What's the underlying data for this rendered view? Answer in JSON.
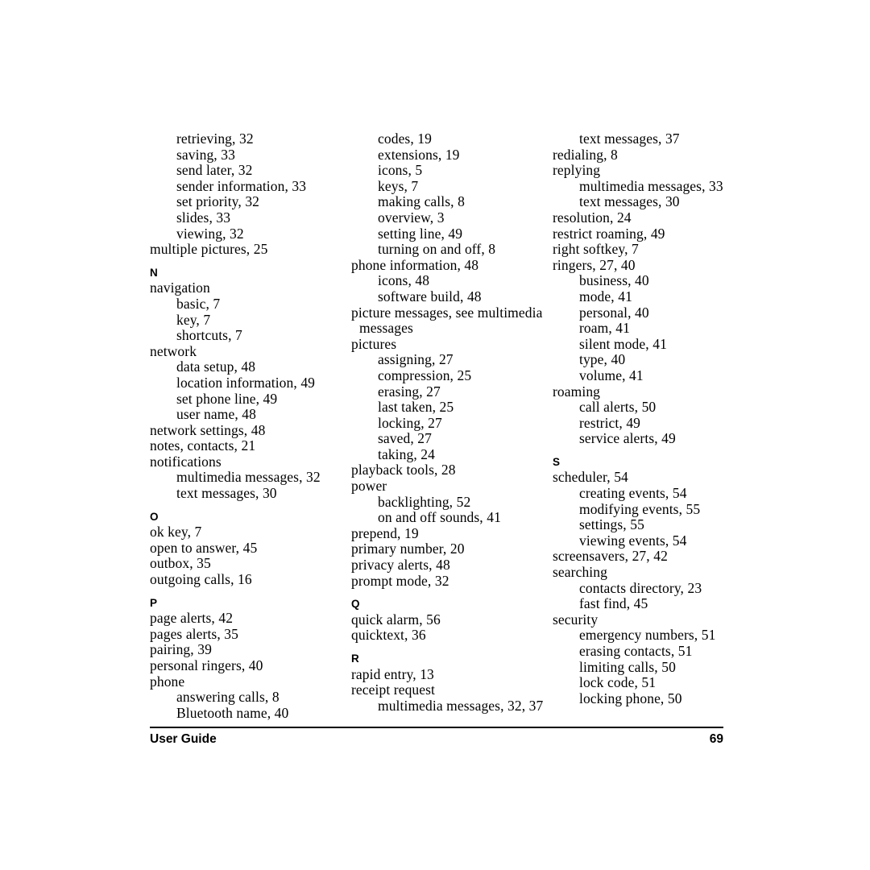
{
  "document": {
    "type": "index-page",
    "page_number": "69",
    "footer": {
      "left_label": "User Guide",
      "right_label": "69"
    },
    "colors": {
      "text": "#000000",
      "background": "#ffffff",
      "rule": "#000000"
    }
  },
  "columns": [
    {
      "id": "column-1",
      "blocks": [
        {
          "type": "entries",
          "entries": [
            {
              "level": 2,
              "text": "retrieving, 32"
            },
            {
              "level": 2,
              "text": "saving, 33"
            },
            {
              "level": 2,
              "text": "send later, 32"
            },
            {
              "level": 2,
              "text": "sender information, 33"
            },
            {
              "level": 2,
              "text": "set priority, 32"
            },
            {
              "level": 2,
              "text": "slides, 33"
            },
            {
              "level": 2,
              "text": "viewing, 32"
            },
            {
              "level": 1,
              "text": "multiple pictures, 25"
            }
          ]
        },
        {
          "type": "letter",
          "letter": "N",
          "entries": [
            {
              "level": 1,
              "text": "navigation"
            },
            {
              "level": 2,
              "text": "basic, 7"
            },
            {
              "level": 2,
              "text": "key, 7"
            },
            {
              "level": 2,
              "text": "shortcuts, 7"
            },
            {
              "level": 1,
              "text": "network"
            },
            {
              "level": 2,
              "text": "data setup, 48"
            },
            {
              "level": 2,
              "text": "location information, 49"
            },
            {
              "level": 2,
              "text": "set phone line, 49"
            },
            {
              "level": 2,
              "text": "user name, 48"
            },
            {
              "level": 1,
              "text": "network settings, 48"
            },
            {
              "level": 1,
              "text": "notes, contacts, 21"
            },
            {
              "level": 1,
              "text": "notifications"
            },
            {
              "level": 2,
              "text": "multimedia messages, 32"
            },
            {
              "level": 2,
              "text": "text messages, 30"
            }
          ]
        },
        {
          "type": "letter",
          "letter": "O",
          "entries": [
            {
              "level": 1,
              "text": "ok key, 7"
            },
            {
              "level": 1,
              "text": "open to answer, 45"
            },
            {
              "level": 1,
              "text": "outbox, 35"
            },
            {
              "level": 1,
              "text": "outgoing calls, 16"
            }
          ]
        },
        {
          "type": "letter",
          "letter": "P",
          "entries": [
            {
              "level": 1,
              "text": "page alerts, 42"
            },
            {
              "level": 1,
              "text": "pages alerts, 35"
            },
            {
              "level": 1,
              "text": "pairing, 39"
            },
            {
              "level": 1,
              "text": "personal ringers, 40"
            },
            {
              "level": 1,
              "text": "phone"
            },
            {
              "level": 2,
              "text": "answering calls, 8"
            },
            {
              "level": 2,
              "text": "Bluetooth name, 40"
            }
          ]
        }
      ]
    },
    {
      "id": "column-2",
      "blocks": [
        {
          "type": "entries",
          "entries": [
            {
              "level": 2,
              "text": "codes, 19"
            },
            {
              "level": 2,
              "text": "extensions, 19"
            },
            {
              "level": 2,
              "text": "icons, 5"
            },
            {
              "level": 2,
              "text": "keys, 7"
            },
            {
              "level": 2,
              "text": "making calls, 8"
            },
            {
              "level": 2,
              "text": "overview, 3"
            },
            {
              "level": 2,
              "text": "setting line, 49"
            },
            {
              "level": 2,
              "text": "turning on and off, 8"
            },
            {
              "level": 1,
              "text": "phone information, 48"
            },
            {
              "level": 2,
              "text": "icons, 48"
            },
            {
              "level": 2,
              "text": "software build, 48"
            },
            {
              "level": 1,
              "wrap": true,
              "text": "picture messages, see multimedia messages"
            },
            {
              "level": 1,
              "text": "pictures"
            },
            {
              "level": 2,
              "text": "assigning, 27"
            },
            {
              "level": 2,
              "text": "compression, 25"
            },
            {
              "level": 2,
              "text": "erasing, 27"
            },
            {
              "level": 2,
              "text": "last taken, 25"
            },
            {
              "level": 2,
              "text": "locking, 27"
            },
            {
              "level": 2,
              "text": "saved, 27"
            },
            {
              "level": 2,
              "text": "taking, 24"
            },
            {
              "level": 1,
              "text": "playback tools, 28"
            },
            {
              "level": 1,
              "text": "power"
            },
            {
              "level": 2,
              "text": "backlighting, 52"
            },
            {
              "level": 2,
              "text": "on and off sounds, 41"
            },
            {
              "level": 1,
              "text": "prepend, 19"
            },
            {
              "level": 1,
              "text": "primary number, 20"
            },
            {
              "level": 1,
              "text": "privacy alerts, 48"
            },
            {
              "level": 1,
              "text": "prompt mode, 32"
            }
          ]
        },
        {
          "type": "letter",
          "letter": "Q",
          "entries": [
            {
              "level": 1,
              "text": "quick alarm, 56"
            },
            {
              "level": 1,
              "text": "quicktext, 36"
            }
          ]
        },
        {
          "type": "letter",
          "letter": "R",
          "entries": [
            {
              "level": 1,
              "text": "rapid entry, 13"
            },
            {
              "level": 1,
              "text": "receipt request"
            },
            {
              "level": 2,
              "text": "multimedia messages, 32, 37"
            }
          ]
        }
      ]
    },
    {
      "id": "column-3",
      "blocks": [
        {
          "type": "entries",
          "entries": [
            {
              "level": 2,
              "text": "text messages, 37"
            },
            {
              "level": 1,
              "text": "redialing, 8"
            },
            {
              "level": 1,
              "text": "replying"
            },
            {
              "level": 2,
              "text": "multimedia messages, 33"
            },
            {
              "level": 2,
              "text": "text messages, 30"
            },
            {
              "level": 1,
              "text": "resolution, 24"
            },
            {
              "level": 1,
              "text": "restrict roaming, 49"
            },
            {
              "level": 1,
              "text": "right softkey, 7"
            },
            {
              "level": 1,
              "text": "ringers, 27, 40"
            },
            {
              "level": 2,
              "text": "business, 40"
            },
            {
              "level": 2,
              "text": "mode, 41"
            },
            {
              "level": 2,
              "text": "personal, 40"
            },
            {
              "level": 2,
              "text": "roam, 41"
            },
            {
              "level": 2,
              "text": "silent mode, 41"
            },
            {
              "level": 2,
              "text": "type, 40"
            },
            {
              "level": 2,
              "text": "volume, 41"
            },
            {
              "level": 1,
              "text": "roaming"
            },
            {
              "level": 2,
              "text": "call alerts, 50"
            },
            {
              "level": 2,
              "text": "restrict, 49"
            },
            {
              "level": 2,
              "text": "service alerts, 49"
            }
          ]
        },
        {
          "type": "letter",
          "letter": "S",
          "entries": [
            {
              "level": 1,
              "text": "scheduler, 54"
            },
            {
              "level": 2,
              "text": "creating events, 54"
            },
            {
              "level": 2,
              "text": "modifying events, 55"
            },
            {
              "level": 2,
              "text": "settings, 55"
            },
            {
              "level": 2,
              "text": "viewing events, 54"
            },
            {
              "level": 1,
              "text": "screensavers, 27, 42"
            },
            {
              "level": 1,
              "text": "searching"
            },
            {
              "level": 2,
              "text": "contacts directory, 23"
            },
            {
              "level": 2,
              "text": "fast find, 45"
            },
            {
              "level": 1,
              "text": "security"
            },
            {
              "level": 2,
              "text": "emergency numbers, 51"
            },
            {
              "level": 2,
              "text": "erasing contacts, 51"
            },
            {
              "level": 2,
              "text": "limiting calls, 50"
            },
            {
              "level": 2,
              "text": "lock code, 51"
            },
            {
              "level": 2,
              "text": "locking phone, 50"
            }
          ]
        }
      ]
    }
  ]
}
